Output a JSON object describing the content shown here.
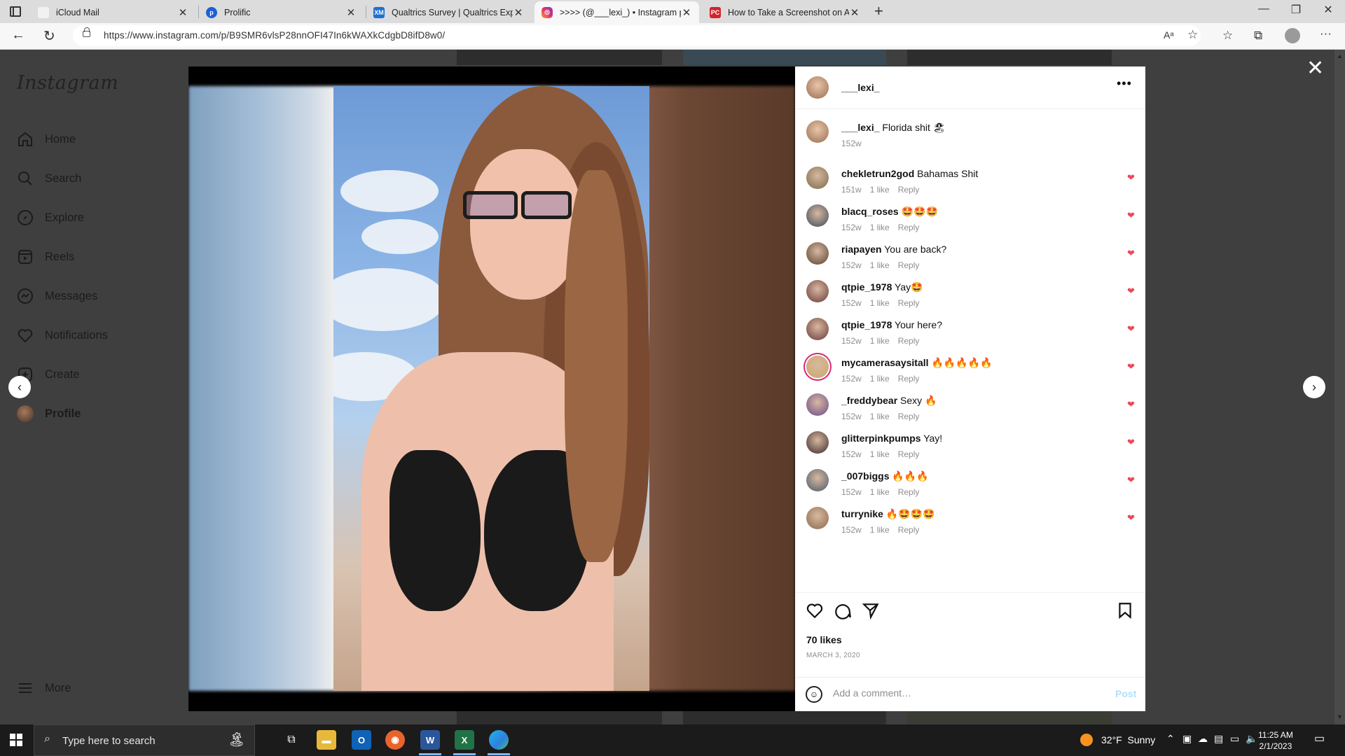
{
  "browser": {
    "tabs": [
      {
        "title": "iCloud Mail",
        "favicon": "apple-icon"
      },
      {
        "title": "Prolific",
        "favicon": "prolific-icon"
      },
      {
        "title": "Qualtrics Survey | Qualtrics Experi…",
        "favicon": "qualtrics-icon"
      },
      {
        "title": ">>>> (@___lexi_) • Instagram p…",
        "favicon": "instagram-icon"
      },
      {
        "title": "How to Take a Screenshot on An…",
        "favicon": "pcmag-icon"
      }
    ],
    "active_tab": 3,
    "url": "https://www.instagram.com/p/B9SMR6vlsP28nnOFI47In6kWAXkCdgbD8ifD8w0/"
  },
  "instagram": {
    "logo": "Instagram",
    "nav": [
      {
        "label": "Home",
        "icon": "home-icon"
      },
      {
        "label": "Search",
        "icon": "search-icon"
      },
      {
        "label": "Explore",
        "icon": "explore-icon"
      },
      {
        "label": "Reels",
        "icon": "reels-icon"
      },
      {
        "label": "Messages",
        "icon": "messages-icon"
      },
      {
        "label": "Notifications",
        "icon": "heart-icon"
      },
      {
        "label": "Create",
        "icon": "create-icon"
      },
      {
        "label": "Profile",
        "icon": "avatar"
      }
    ],
    "more_label": "More"
  },
  "post": {
    "author": "___lexi_",
    "caption_user": "___lexi_",
    "caption_text": "Florida shit 🏖",
    "caption_age": "152w",
    "comments": [
      {
        "user": "chekletrun2god",
        "text": "Bahamas Shit",
        "age": "151w",
        "likes": "1 like",
        "reply": "Reply"
      },
      {
        "user": "blacq_roses",
        "text": "🤩🤩🤩",
        "age": "152w",
        "likes": "1 like",
        "reply": "Reply"
      },
      {
        "user": "riapayen",
        "text": "You are back?",
        "age": "152w",
        "likes": "1 like",
        "reply": "Reply"
      },
      {
        "user": "qtpie_1978",
        "text": "Yay🤩",
        "age": "152w",
        "likes": "1 like",
        "reply": "Reply"
      },
      {
        "user": "qtpie_1978",
        "text": "Your here?",
        "age": "152w",
        "likes": "1 like",
        "reply": "Reply"
      },
      {
        "user": "mycamerasaysitall",
        "text": "🔥🔥🔥🔥🔥",
        "age": "152w",
        "likes": "1 like",
        "reply": "Reply"
      },
      {
        "user": "_freddybear",
        "text": "Sexy 🔥",
        "age": "152w",
        "likes": "1 like",
        "reply": "Reply"
      },
      {
        "user": "glitterpinkpumps",
        "text": "Yay!",
        "age": "152w",
        "likes": "1 like",
        "reply": "Reply"
      },
      {
        "user": "_007biggs",
        "text": "🔥🔥🔥",
        "age": "152w",
        "likes": "1 like",
        "reply": "Reply"
      },
      {
        "user": "turrynike",
        "text": "🔥🤩🤩🤩",
        "age": "152w",
        "likes": "1 like",
        "reply": "Reply"
      }
    ],
    "likes": "70 likes",
    "date": "MARCH 3, 2020",
    "comment_placeholder": "Add a comment…",
    "post_button": "Post",
    "heart_color": "#ed4956"
  },
  "taskbar": {
    "search_placeholder": "Type here to search",
    "weather": "32°F  Sunny",
    "time": "11:25 AM",
    "date": "2/1/2023"
  }
}
